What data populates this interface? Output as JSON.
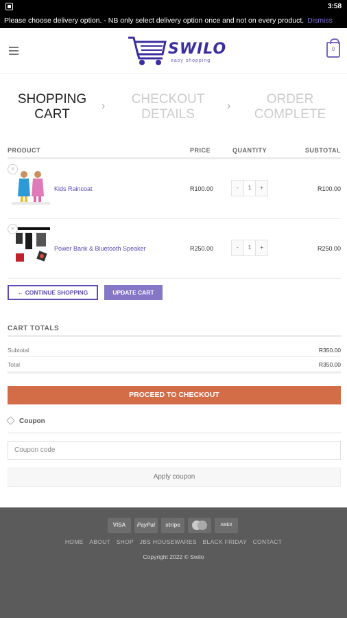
{
  "status_bar": {
    "time": "3:58"
  },
  "notice": {
    "text": "Please choose delivery option. - NB only select delivery option once and not on every product.",
    "dismiss": "Dismiss"
  },
  "header": {
    "logo_text": "SWILO",
    "logo_tagline": "easy shopping",
    "cart_count": "0"
  },
  "steps": [
    {
      "line1": "SHOPPING",
      "line2": "CART"
    },
    {
      "line1": "CHECKOUT",
      "line2": "DETAILS"
    },
    {
      "line1": "ORDER",
      "line2": "COMPLETE"
    }
  ],
  "table": {
    "headers": {
      "product": "PRODUCT",
      "price": "PRICE",
      "quantity": "QUANTITY",
      "subtotal": "SUBTOTAL"
    },
    "rows": [
      {
        "name": "Kids Raincoat",
        "price": "R100.00",
        "qty": "1",
        "subtotal": "R100.00"
      },
      {
        "name": "Power Bank & Bluetooth Speaker",
        "price": "R250.00",
        "qty": "1",
        "subtotal": "R250.00"
      }
    ],
    "minus": "-",
    "plus": "+"
  },
  "buttons": {
    "continue": "← CONTINUE SHOPPING",
    "update": "UPDATE CART"
  },
  "cart_totals": {
    "title": "CART TOTALS",
    "subtotal_label": "Subtotal",
    "subtotal_value": "R350.00",
    "total_label": "Total",
    "total_value": "R350.00",
    "checkout": "PROCEED TO CHECKOUT"
  },
  "coupon": {
    "title": "Coupon",
    "placeholder": "Coupon code",
    "apply": "Apply coupon"
  },
  "footer": {
    "payment": [
      "VISA",
      "PayPal",
      "stripe",
      "",
      "AMEX"
    ],
    "nav": [
      "HOME",
      "ABOUT",
      "SHOP",
      "JBS HOUSEWARES",
      "BLACK FRIDAY",
      "CONTACT"
    ],
    "copyright": "Copyright 2022 © Swilo"
  },
  "colors": {
    "brand": "#3b2ea0",
    "accent": "#8577c6",
    "checkout": "#d26d48",
    "footer": "#5b5b5b"
  }
}
